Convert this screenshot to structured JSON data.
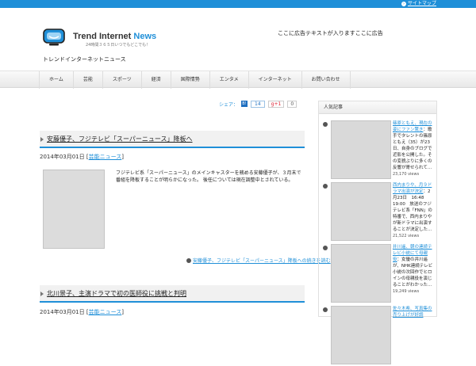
{
  "topbar": {
    "sitemap_label": "サイトマップ"
  },
  "header": {
    "brand_main": "Trend Internet",
    "brand_accent": "News",
    "tagline": "24時間３６５日いつでもどこでも！",
    "description": "トレンドインターネットニュース",
    "ad_text": "ここに広告テキストが入りますここに広告"
  },
  "nav": {
    "items": [
      "ホーム",
      "芸能",
      "スポーツ",
      "経済",
      "国際情勢",
      "エンタメ",
      "インターネット",
      "お問い合わせ"
    ]
  },
  "share": {
    "label": "シェア：",
    "hatena_icon": "B!",
    "hatena_count": "14",
    "gplus_label": "g+1",
    "gplus_count": "0"
  },
  "posts": [
    {
      "title": "安藤優子、フジテレビ「スーパーニュース」降板へ",
      "date": "2014年03月01日",
      "category": "芸能ニュース",
      "excerpt": "フジテレビ系「スーパーニュース」のメインキャスターを務める安藤優子が、３月末で番組を降板することが明らかになった。 後任については現在調整中とされている。",
      "readmore": "安藤優子、フジテレビ「スーパーニュース」降板への続きを読む"
    },
    {
      "title": "北川景子、主演ドラマで初の医師役に挑戦と判明",
      "date": "2014年03月01日",
      "category": "芸能ニュース"
    }
  ],
  "sidebar": {
    "heading": "人気記事",
    "items": [
      {
        "title": "篠原ともえ、現在の姿にファン驚き",
        "body": "：歌手でタレントの篠原ともえ（35）が23日、自身のブログで近影を公開した。その変貌ぶりに多くの反響が寄せられて…",
        "views": "23,170 views"
      },
      {
        "title": "西内まりや、月９ドラマ出演が決定",
        "body": "：2月23日　16:48　19:00　放送のフジテレビ系「FNN」の特番で、西内まりやが新ドラマに出演することが決定した…",
        "views": "21,522 views"
      },
      {
        "title": "井川遥、朝の連続テレビ小説にて母親役",
        "body": "：女優の井川遥が、NHK連続テレビ小説の次回作でヒロインの母親役を演じることがわかった…",
        "views": "19,249 views"
      },
      {
        "title": "佐々木希、写真集の売り上げが好調",
        "body": "",
        "views": ""
      }
    ]
  }
}
